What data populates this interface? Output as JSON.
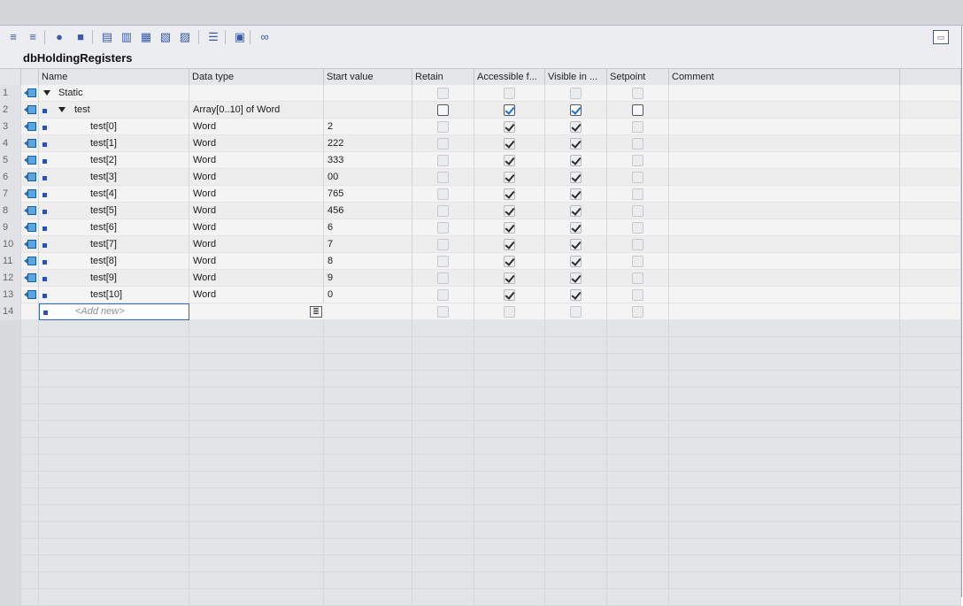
{
  "block_name": "dbHoldingRegisters",
  "toolbar": {
    "icons": [
      "insert-row-icon",
      "add-row-icon",
      "expand-icon",
      "collapse-icon",
      "snapshot-icon",
      "copy-snapshot-icon",
      "load-snapshot-icon",
      "load-start-icon",
      "load-actual-icon",
      "indent-icon",
      "monitor-icon",
      "glasses-icon"
    ],
    "right_icon": "layout-toggle-icon"
  },
  "columns": [
    "Name",
    "Data type",
    "Start value",
    "Retain",
    "Accessible f...",
    "Visible in ...",
    "Setpoint",
    "Comment"
  ],
  "rows": [
    {
      "num": "1",
      "name": "Static",
      "type": "",
      "start": "",
      "level": 0,
      "expand": true,
      "bullet": false,
      "retain": "dim",
      "access": "dim",
      "visible": "dim",
      "setpoint": "dim"
    },
    {
      "num": "2",
      "name": "test",
      "type": "Array[0..10] of Word",
      "start": "",
      "level": 1,
      "expand": true,
      "bullet": true,
      "retain": "active",
      "access": "active-checked",
      "visible": "active-checked",
      "setpoint": "active"
    },
    {
      "num": "3",
      "name": "test[0]",
      "type": "Word",
      "start": "2",
      "level": 2,
      "expand": false,
      "bullet": true,
      "retain": "dim",
      "access": "checked",
      "visible": "checked",
      "setpoint": "dim"
    },
    {
      "num": "4",
      "name": "test[1]",
      "type": "Word",
      "start": "222",
      "level": 2,
      "expand": false,
      "bullet": true,
      "retain": "dim",
      "access": "checked",
      "visible": "checked",
      "setpoint": "dim"
    },
    {
      "num": "5",
      "name": "test[2]",
      "type": "Word",
      "start": "333",
      "level": 2,
      "expand": false,
      "bullet": true,
      "retain": "dim",
      "access": "checked",
      "visible": "checked",
      "setpoint": "dim"
    },
    {
      "num": "6",
      "name": "test[3]",
      "type": "Word",
      "start": "00",
      "level": 2,
      "expand": false,
      "bullet": true,
      "retain": "dim",
      "access": "checked",
      "visible": "checked",
      "setpoint": "dim"
    },
    {
      "num": "7",
      "name": "test[4]",
      "type": "Word",
      "start": "765",
      "level": 2,
      "expand": false,
      "bullet": true,
      "retain": "dim",
      "access": "checked",
      "visible": "checked",
      "setpoint": "dim"
    },
    {
      "num": "8",
      "name": "test[5]",
      "type": "Word",
      "start": "456",
      "level": 2,
      "expand": false,
      "bullet": true,
      "retain": "dim",
      "access": "checked",
      "visible": "checked",
      "setpoint": "dim"
    },
    {
      "num": "9",
      "name": "test[6]",
      "type": "Word",
      "start": "6",
      "level": 2,
      "expand": false,
      "bullet": true,
      "retain": "dim",
      "access": "checked",
      "visible": "checked",
      "setpoint": "dim"
    },
    {
      "num": "10",
      "name": "test[7]",
      "type": "Word",
      "start": "7",
      "level": 2,
      "expand": false,
      "bullet": true,
      "retain": "dim",
      "access": "checked",
      "visible": "checked",
      "setpoint": "dim"
    },
    {
      "num": "11",
      "name": "test[8]",
      "type": "Word",
      "start": "8",
      "level": 2,
      "expand": false,
      "bullet": true,
      "retain": "dim",
      "access": "checked",
      "visible": "checked",
      "setpoint": "dim"
    },
    {
      "num": "12",
      "name": "test[9]",
      "type": "Word",
      "start": "9",
      "level": 2,
      "expand": false,
      "bullet": true,
      "retain": "dim",
      "access": "checked",
      "visible": "checked",
      "setpoint": "dim"
    },
    {
      "num": "13",
      "name": "test[10]",
      "type": "Word",
      "start": "0",
      "level": 2,
      "expand": false,
      "bullet": true,
      "retain": "dim",
      "access": "checked",
      "visible": "checked",
      "setpoint": "dim"
    }
  ],
  "add_new": {
    "num": "14",
    "placeholder": "<Add new>"
  },
  "colors": {
    "accent": "#2f67c9",
    "bullet": "#2d50b8",
    "checkbox_blue": "#1f6fd0"
  }
}
